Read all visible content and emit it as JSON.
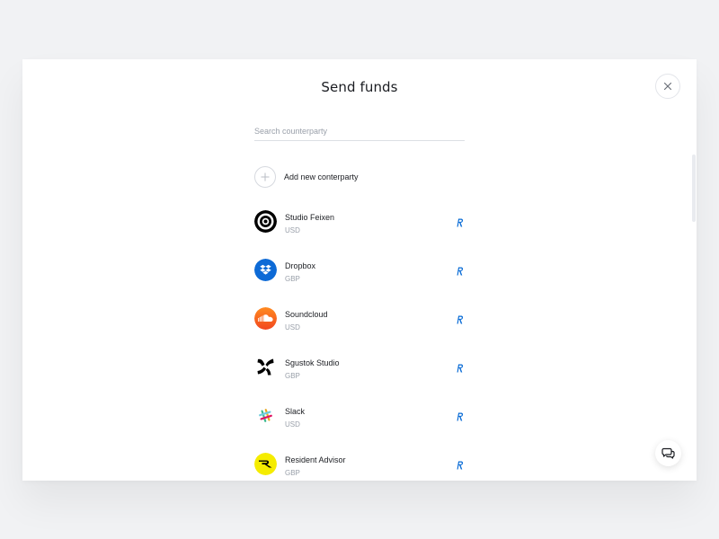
{
  "modal": {
    "title": "Send funds",
    "close_icon": "close-icon"
  },
  "search": {
    "placeholder": "Search counterparty",
    "value": ""
  },
  "add_new": {
    "label": "Add new conterparty",
    "icon": "plus-icon"
  },
  "counterparties": [
    {
      "name": "Studio Feixen",
      "currency": "USD",
      "logo": "target-logo"
    },
    {
      "name": "Dropbox",
      "currency": "GBP",
      "logo": "dropbox-logo"
    },
    {
      "name": "Soundcloud",
      "currency": "USD",
      "logo": "soundcloud-logo"
    },
    {
      "name": "Sgustok Studio",
      "currency": "GBP",
      "logo": "sgustok-logo"
    },
    {
      "name": "Slack",
      "currency": "USD",
      "logo": "slack-logo"
    },
    {
      "name": "Resident Advisor",
      "currency": "GBP",
      "logo": "ra-logo"
    }
  ],
  "badge_icon": "revolut-r-icon",
  "chat_icon": "chat-bubbles-icon",
  "colors": {
    "accent_blue": "#0a6cd6",
    "dropbox_blue": "#0d6ad6",
    "soundcloud_orange": "#f55a22",
    "resident_advisor_yellow": "#f5ec00",
    "page_background": "#f1f2f4",
    "text_primary": "#1b1d22",
    "text_secondary": "#9aa0aa"
  }
}
